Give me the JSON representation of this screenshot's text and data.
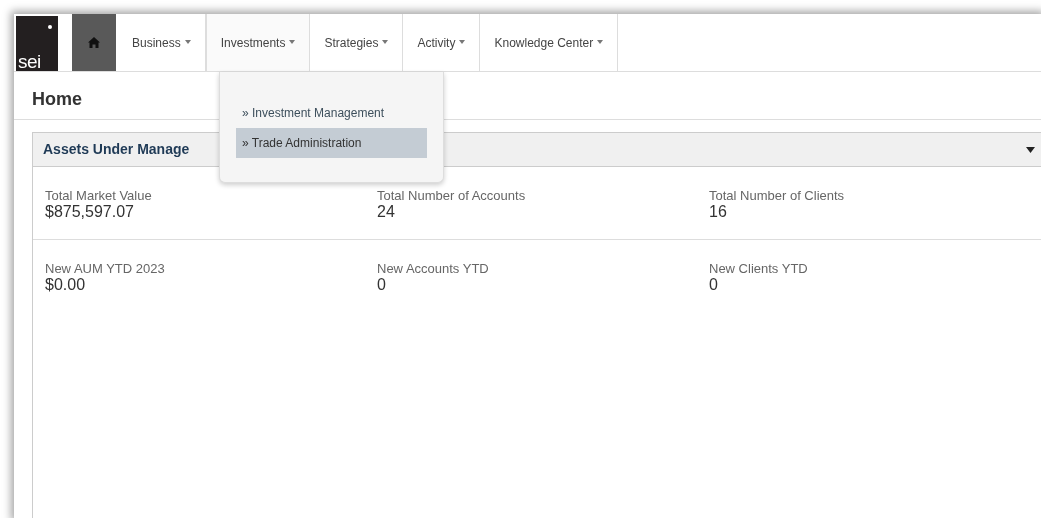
{
  "logo": {
    "text": "sei"
  },
  "nav": [
    {
      "label": "Business",
      "selected": false
    },
    {
      "label": "Investments",
      "selected": true
    },
    {
      "label": "Strategies",
      "selected": false
    },
    {
      "label": "Activity",
      "selected": false
    },
    {
      "label": "Knowledge Center",
      "selected": false
    }
  ],
  "dropdown": {
    "items": [
      {
        "label": "» Investment Management",
        "selected": false
      },
      {
        "label": "» Trade Administration",
        "selected": true
      }
    ]
  },
  "page_title": "Home",
  "panel": {
    "title": "Assets Under Manage",
    "rows": [
      [
        {
          "label": "Total Market Value",
          "value": "$875,597.07"
        },
        {
          "label": "Total Number of Accounts",
          "value": "24"
        },
        {
          "label": "Total Number of Clients",
          "value": "16"
        }
      ],
      [
        {
          "label": "New AUM YTD 2023",
          "value": "$0.00"
        },
        {
          "label": "New Accounts YTD",
          "value": "0"
        },
        {
          "label": "New Clients YTD",
          "value": "0"
        }
      ]
    ]
  }
}
